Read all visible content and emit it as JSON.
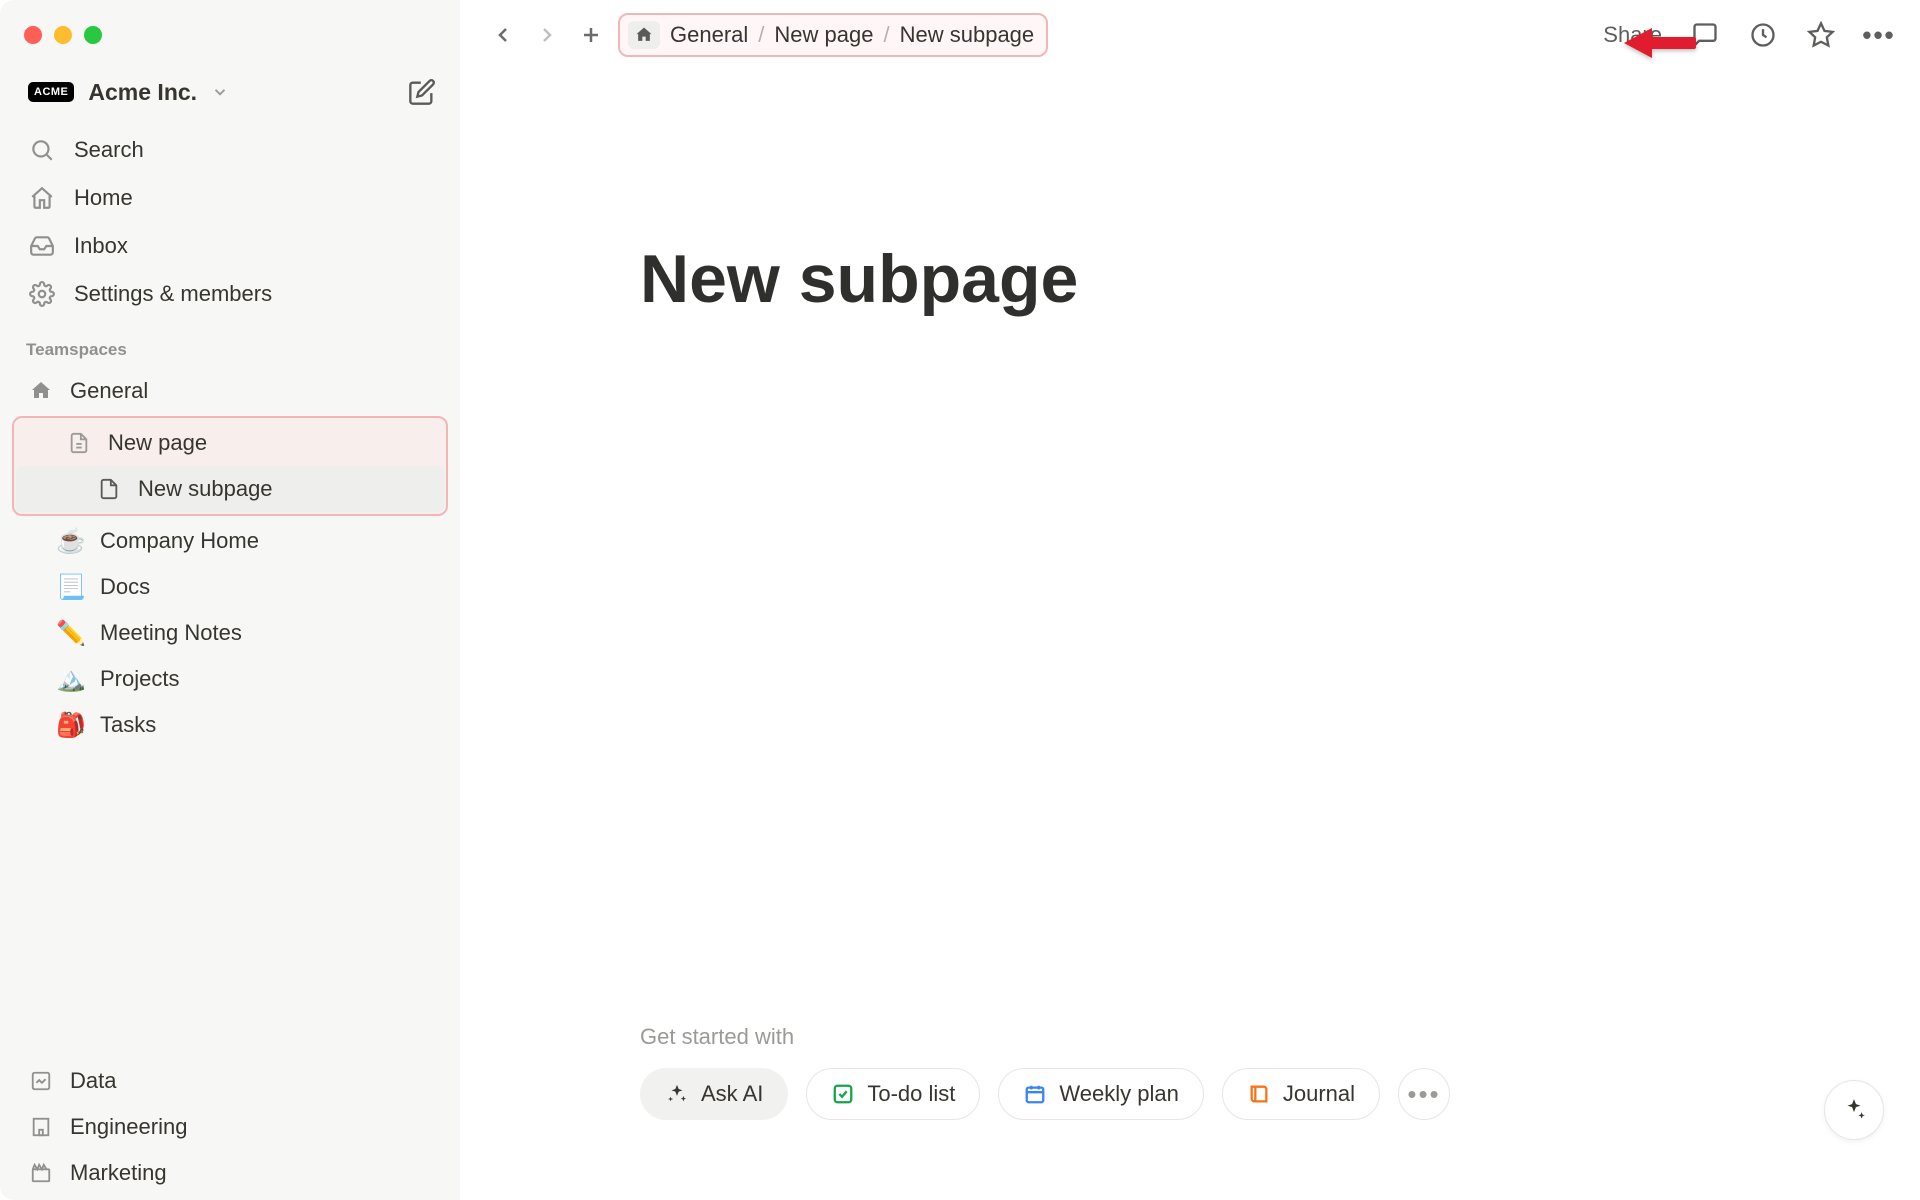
{
  "workspace": {
    "badge": "ACME",
    "name": "Acme Inc."
  },
  "sidebar": {
    "search": "Search",
    "home": "Home",
    "inbox": "Inbox",
    "settings": "Settings & members",
    "section_label": "Teamspaces",
    "bottom": {
      "data": "Data",
      "engineering": "Engineering",
      "marketing": "Marketing"
    }
  },
  "tree": {
    "general": "General",
    "new_page": "New page",
    "new_subpage": "New subpage",
    "company_home": "Company Home",
    "docs": "Docs",
    "meeting_notes": "Meeting Notes",
    "projects": "Projects",
    "tasks": "Tasks",
    "icons": {
      "company_home": "☕",
      "docs": "📃",
      "meeting_notes": "✏️",
      "projects": "🏔️",
      "tasks": "🎒"
    }
  },
  "breadcrumb": {
    "a": "General",
    "b": "New page",
    "c": "New subpage"
  },
  "topbar": {
    "share": "Share"
  },
  "page": {
    "title": "New subpage"
  },
  "starter": {
    "label": "Get started with",
    "ask_ai": "Ask AI",
    "todo": "To-do list",
    "weekly": "Weekly plan",
    "journal": "Journal"
  }
}
